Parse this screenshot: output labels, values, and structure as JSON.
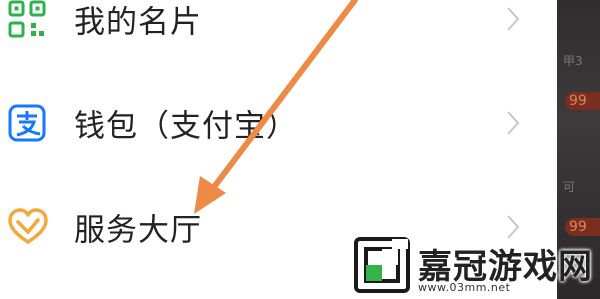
{
  "menu": {
    "items": [
      {
        "label": "我的名片",
        "icon": "qr-code-icon",
        "color": "#2bb24c"
      },
      {
        "label": "钱包（支付宝）",
        "icon": "alipay-icon",
        "color": "#1677ff"
      },
      {
        "label": "服务大厅",
        "icon": "heart-service-icon",
        "color": "#f2a83b"
      }
    ]
  },
  "side_panel": {
    "texts": [
      "甲3",
      "可"
    ],
    "badges": [
      "99",
      "99"
    ]
  },
  "colors": {
    "arrow": "#ee8a45",
    "badge_bg": "#7a2e1f",
    "badge_text": "#d8855d"
  },
  "watermark": {
    "title": "嘉冠游戏网",
    "url": "www.03mm.net"
  }
}
